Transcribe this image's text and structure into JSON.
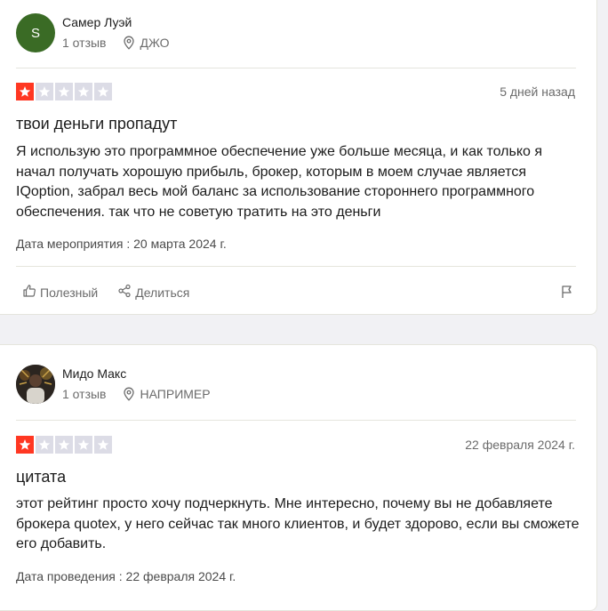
{
  "reviews": [
    {
      "avatar_letter": "S",
      "author": "Самер Луэй",
      "review_count": "1 отзыв",
      "location": "ДЖО",
      "rating": 1,
      "date": "5 дней назад",
      "title": "твои деньги пропадут",
      "body": "Я использую это программное обеспечение уже больше месяца, и как только я начал получать хорошую прибыль, брокер, которым в моем случае является IQoption, забрал весь мой баланс за использование стороннего программного обеспечения. так что не советую тратить на это деньги",
      "experience_date": "Дата мероприятия : 20 марта 2024 г.",
      "useful_label": "Полезный",
      "share_label": "Делиться"
    },
    {
      "author": "Мидо Макс",
      "review_count": "1 отзыв",
      "location": "НАПРИМЕР",
      "rating": 1,
      "date": "22 февраля 2024 г.",
      "title": "цитата",
      "body": "этот рейтинг просто хочу подчеркнуть. Мне интересно, почему вы не добавляете брокера quotex, у него сейчас так много клиентов, и будет здорово, если вы сможете его добавить.",
      "experience_date": "Дата проведения : 22 февраля 2024 г."
    }
  ],
  "colors": {
    "star_active": "#ff3722",
    "star_inactive": "#dcdce6",
    "avatar_s": "#3a6b25"
  },
  "icons": [
    "map-pin-icon",
    "star-icon",
    "thumbs-up-icon",
    "share-icon",
    "flag-icon"
  ]
}
